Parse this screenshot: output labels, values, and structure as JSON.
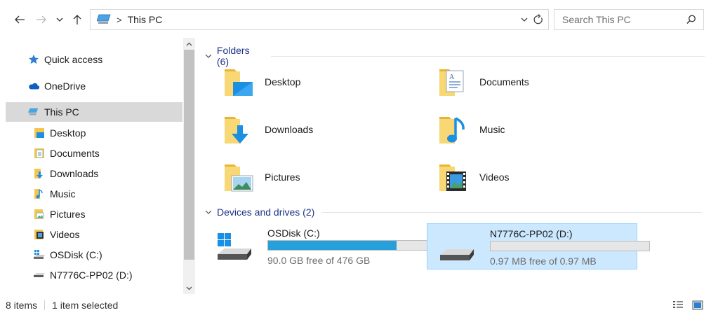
{
  "address": {
    "crumbs": [
      "This PC"
    ],
    "search_placeholder": "Search This PC"
  },
  "icons": {
    "back": "arrow-left-icon",
    "forward": "arrow-right-icon",
    "recent": "chevron-down-icon",
    "up": "arrow-up-icon",
    "refresh": "refresh-icon",
    "search": "search-icon"
  },
  "nav": {
    "quick_access": "Quick access",
    "onedrive": "OneDrive",
    "this_pc": "This PC",
    "items": [
      "Desktop",
      "Documents",
      "Downloads",
      "Music",
      "Pictures",
      "Videos",
      "OSDisk (C:)",
      "N7776C-PP02 (D:)"
    ]
  },
  "content": {
    "folders_header": "Folders (6)",
    "folders": [
      "Desktop",
      "Documents",
      "Downloads",
      "Music",
      "Pictures",
      "Videos"
    ],
    "drives_header": "Devices and drives (2)",
    "drives": [
      {
        "name": "OSDisk (C:)",
        "free_text": "90.0 GB free of 476 GB",
        "used_fraction": 0.811,
        "selected": false
      },
      {
        "name": "N7776C-PP02 (D:)",
        "free_text": "0.97 MB free of 0.97 MB",
        "used_fraction": 0.0,
        "selected": true
      }
    ]
  },
  "status": {
    "item_count": "8 items",
    "selection": "1 item selected"
  },
  "colors": {
    "accent": "#26a0da",
    "selection_bg": "#cce8ff",
    "selection_border": "#99d1ff",
    "nav_selected": "#d9d9d9",
    "group_header": "#1e3287"
  }
}
